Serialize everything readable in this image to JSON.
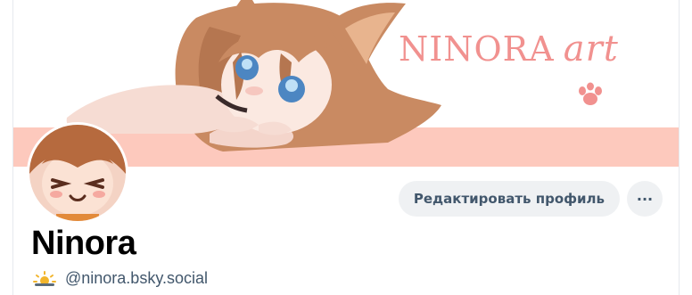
{
  "banner": {
    "brand_name": "NINORA",
    "brand_script": "art",
    "stripe_color": "#fdc9bd",
    "brand_color": "#f1918f"
  },
  "profile": {
    "display_name": "Ninora",
    "handle": "@ninora.bsky.social",
    "badge_icon": "sun-cloud-icon"
  },
  "actions": {
    "edit_label": "Редактировать профиль",
    "more_label": "···"
  }
}
